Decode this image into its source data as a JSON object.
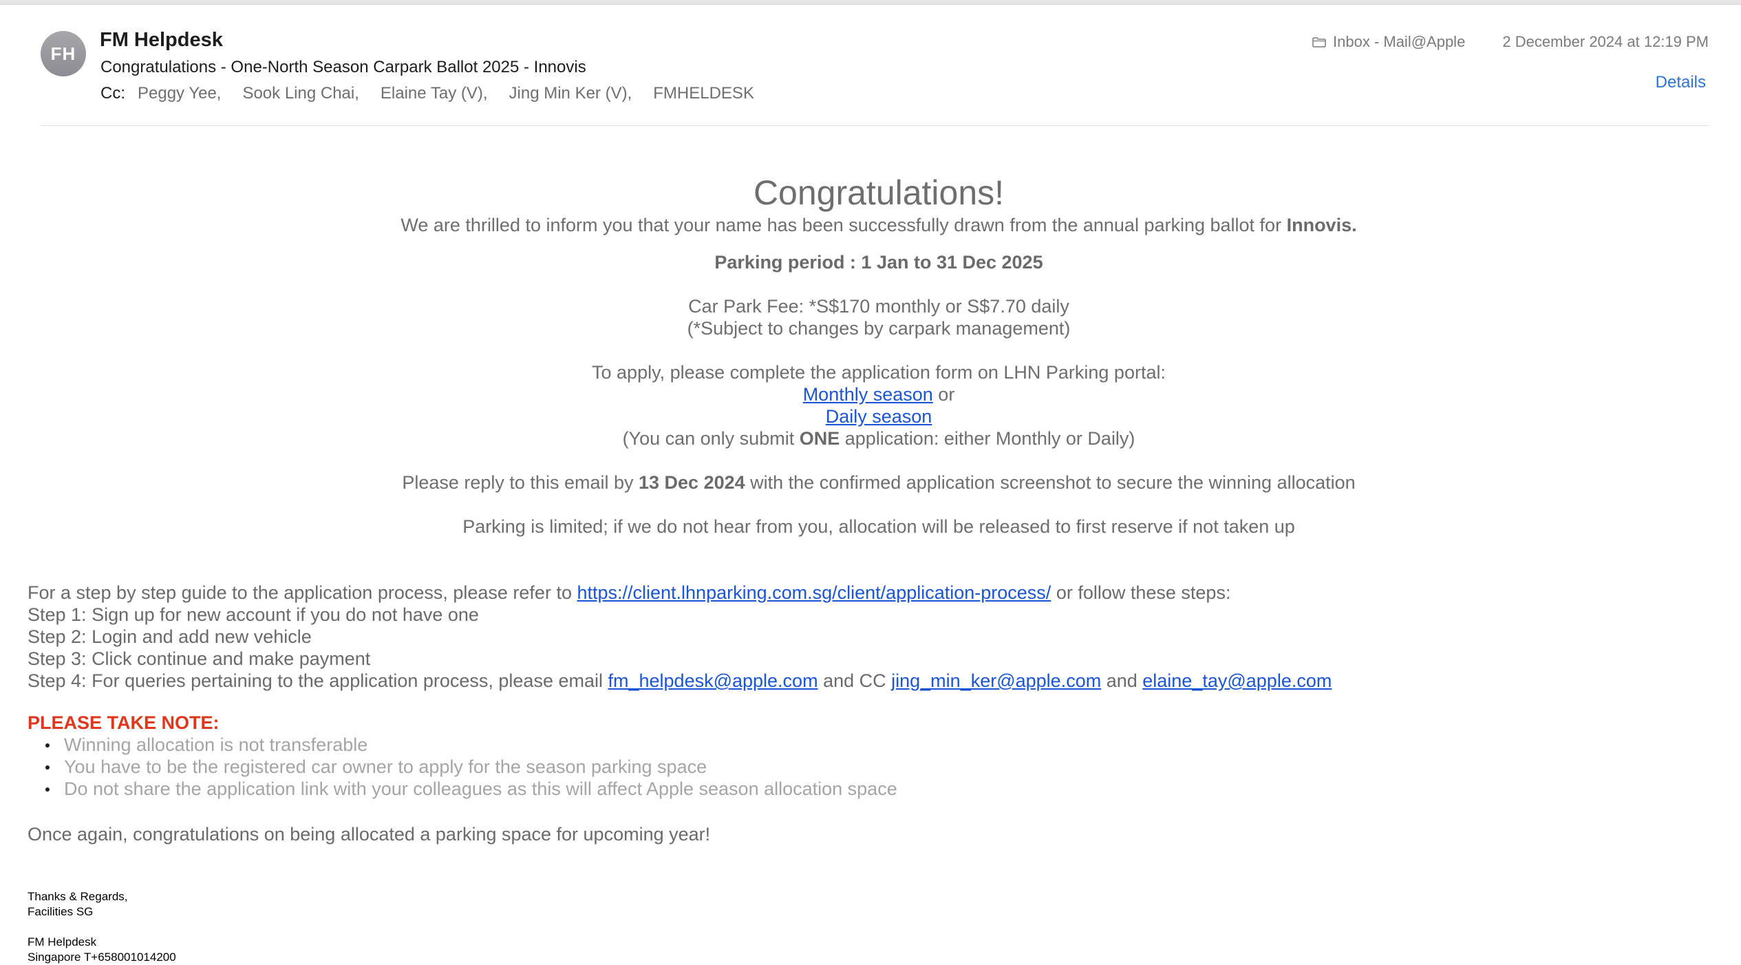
{
  "header": {
    "avatar_initials": "FH",
    "sender": "FM Helpdesk",
    "subject": "Congratulations - One-North Season Carpark Ballot 2025 - Innovis",
    "cc_label": "Cc:",
    "cc": [
      "Peggy Yee,",
      "Sook Ling Chai,",
      "Elaine Tay (V),",
      "Jing Min Ker (V),",
      "FMHELDESK"
    ],
    "mailbox": "Inbox - Mail@Apple",
    "date": "2 December 2024 at 12:19 PM",
    "details_label": "Details"
  },
  "body": {
    "congrats_heading": "Congratulations!",
    "intro_text": "We are thrilled to inform you that your name has been successfully drawn from the annual parking ballot for",
    "intro_bold": "Innovis.",
    "parking_period": "Parking period : 1 Jan to 31 Dec 2025",
    "fee_line": "Car Park Fee:  *S$170 monthly or S$7.70 daily",
    "fee_note": "(*Subject to changes by carpark management)",
    "apply_line": "To apply, please complete the application form on LHN Parking portal:",
    "monthly_link": "Monthly season",
    "or_word": " or",
    "daily_link": "Daily season",
    "one_app_pre": "(You can only submit ",
    "one_app_bold": "ONE",
    "one_app_post": " application: either Monthly or Daily)",
    "reply_pre": "Please reply to this email by ",
    "reply_bold": "13 Dec 2024",
    "reply_post": " with the confirmed application screenshot to secure the winning allocation",
    "limited_line": "Parking is limited; if we do not hear from you, allocation will be released to first reserve if not taken up",
    "guide_pre": "For a step by step guide to the application process, please refer to ",
    "guide_link": "https://client.lhnparking.com.sg/client/application-process/",
    "guide_post": " or follow these steps:",
    "step1": "Step 1: Sign up for new account if you do not have one",
    "step2": "Step 2: Login and add new vehicle",
    "step3": "Step 3: Click continue and make payment",
    "step4_pre": "Step 4: For queries pertaining to the application process, please email ",
    "step4_email1": "fm_helpdesk@apple.com",
    "step4_mid": " and CC ",
    "step4_email2": "jing_min_ker@apple.com",
    "step4_and": " and ",
    "step4_email3": "elaine_tay@apple.com",
    "note_title": "PLEASE TAKE NOTE:",
    "notes": [
      "Winning allocation is not transferable",
      "You have to be the registered car owner to apply for the season parking space",
      "Do not share the application link with your colleagues as this will affect Apple season allocation space"
    ],
    "closing": "Once again, congratulations on being allocated a parking space for upcoming year!",
    "sig_regards": "Thanks & Regards,",
    "sig_team": "Facilities SG",
    "sig_name": "FM Helpdesk",
    "sig_contact": "Singapore T+658001014200"
  }
}
